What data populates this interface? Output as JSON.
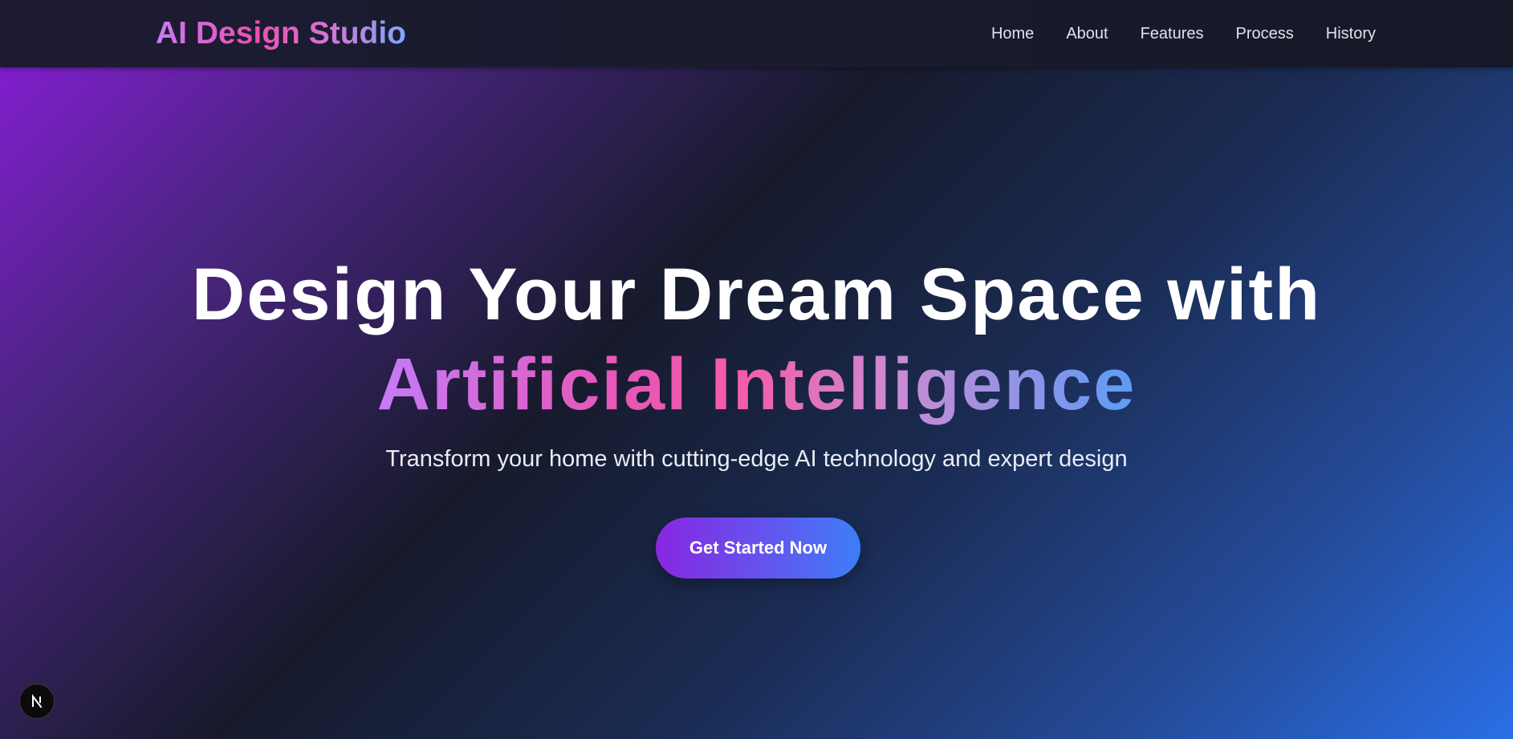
{
  "nav": {
    "brand": "AI Design Studio",
    "links": [
      "Home",
      "About",
      "Features",
      "Process",
      "History"
    ]
  },
  "hero": {
    "headline_line1": "Design Your Dream Space with",
    "headline_line2": "Artificial Intelligence",
    "subtitle": "Transform your home with cutting-edge AI technology and expert design",
    "cta_label": "Get Started Now"
  },
  "dev_badge": {
    "icon": "nextjs-logo-icon",
    "letter": "N"
  },
  "colors": {
    "brand_gradient": [
      "#c57cf5",
      "#ec4fb0",
      "#7ea7fb"
    ],
    "cta_gradient": [
      "#8727e0",
      "#3d7ef7"
    ],
    "background_gradient": [
      "#8a1ddb",
      "#171a2c",
      "#2a6ee6"
    ]
  }
}
